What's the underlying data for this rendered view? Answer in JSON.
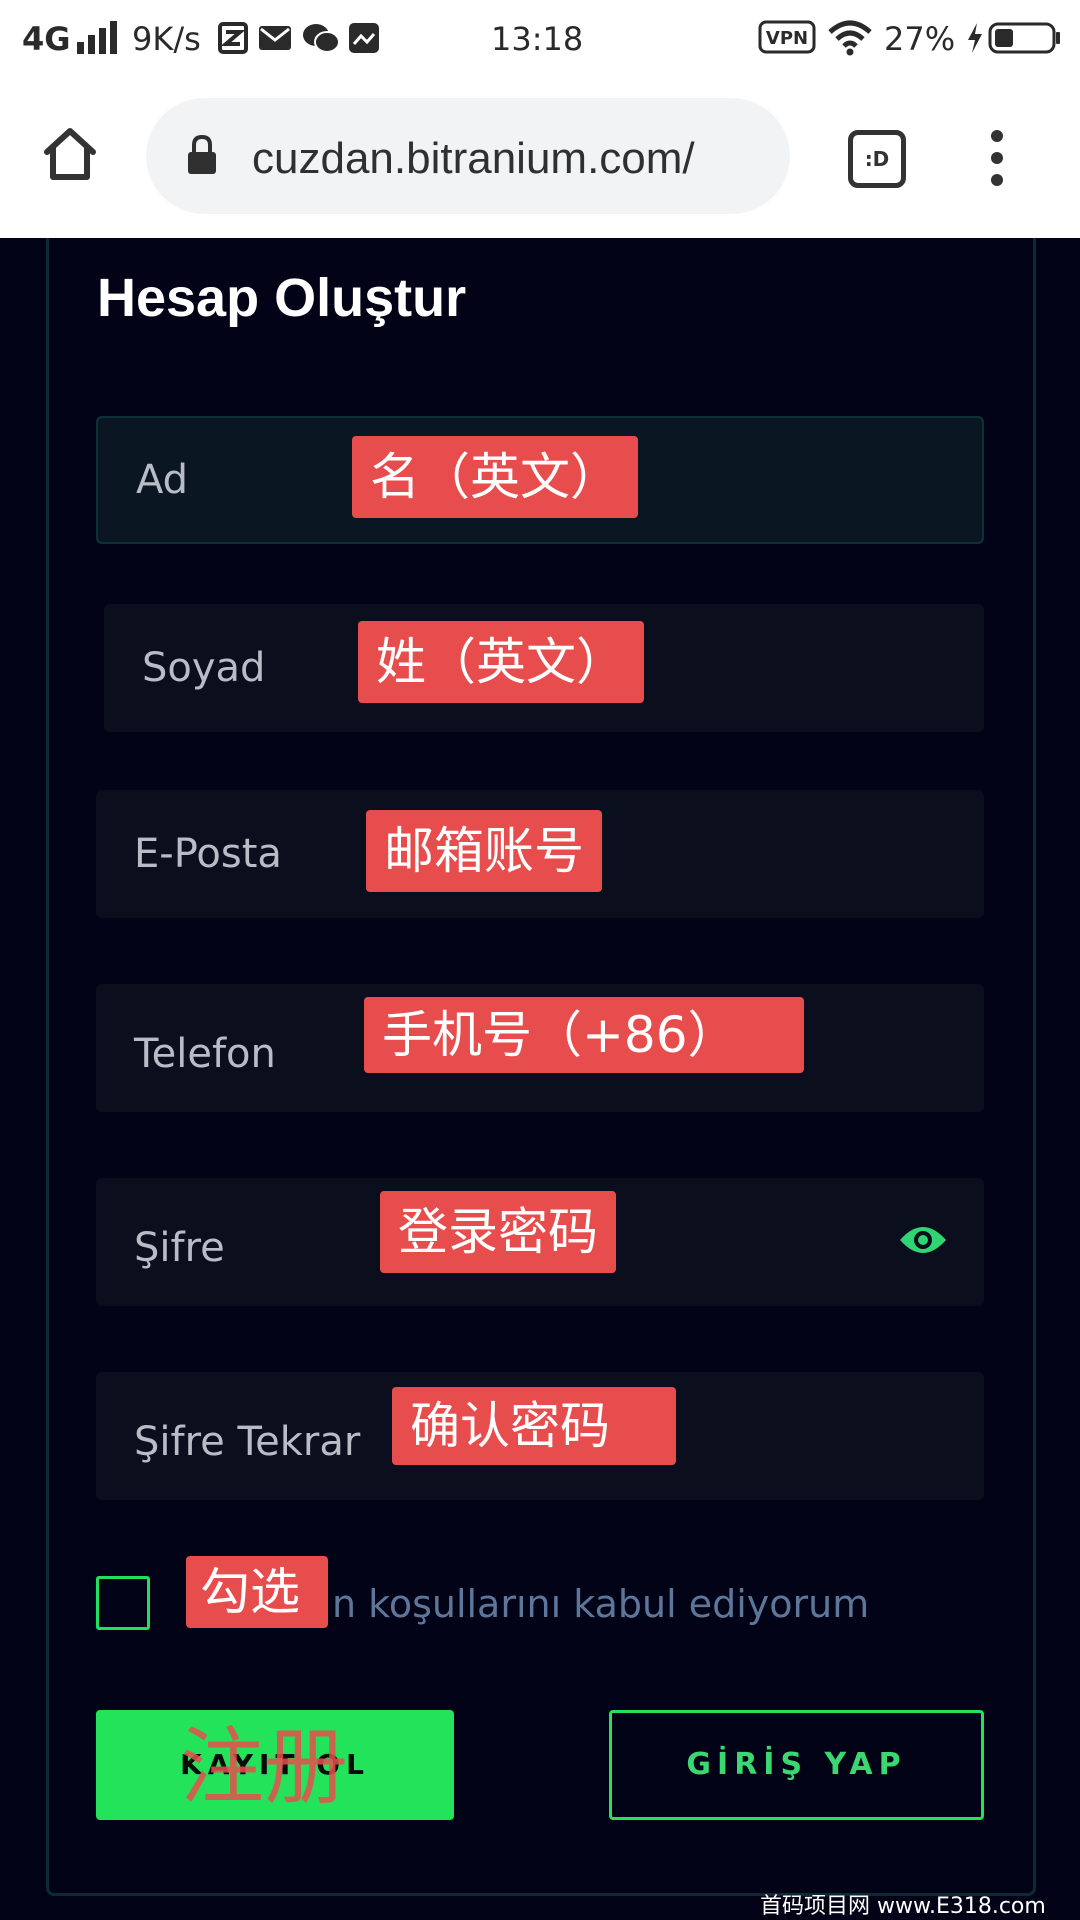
{
  "status_bar": {
    "network": "4G",
    "speed": "9K/s",
    "time": "13:18",
    "vpn": "VPN",
    "battery_pct": "27%"
  },
  "browser": {
    "url": "cuzdan.bitranium.com/",
    "tab_button": ":D"
  },
  "form": {
    "title": "Hesap Oluştur",
    "fields": [
      {
        "label": "Ad",
        "annotation": "名（英文）"
      },
      {
        "label": "Soyad",
        "annotation": "姓（英文）"
      },
      {
        "label": "E-Posta",
        "annotation": "邮箱账号"
      },
      {
        "label": "Telefon",
        "annotation": "手机号（+86）"
      },
      {
        "label": "Şifre",
        "annotation": "登录密码"
      },
      {
        "label": "Şifre Tekrar",
        "annotation": "确认密码"
      }
    ],
    "terms_text": "n koşullarını kabul ediyorum",
    "terms_annotation": "勾选",
    "register_button": "KAYIT OL",
    "register_annotation": "注册",
    "login_button": "GİRİŞ YAP"
  },
  "watermark": "首码项目网 www.E318.com",
  "colors": {
    "background": "#020316",
    "accent_green": "#22e35a",
    "annotation_red": "#e84d4d"
  }
}
